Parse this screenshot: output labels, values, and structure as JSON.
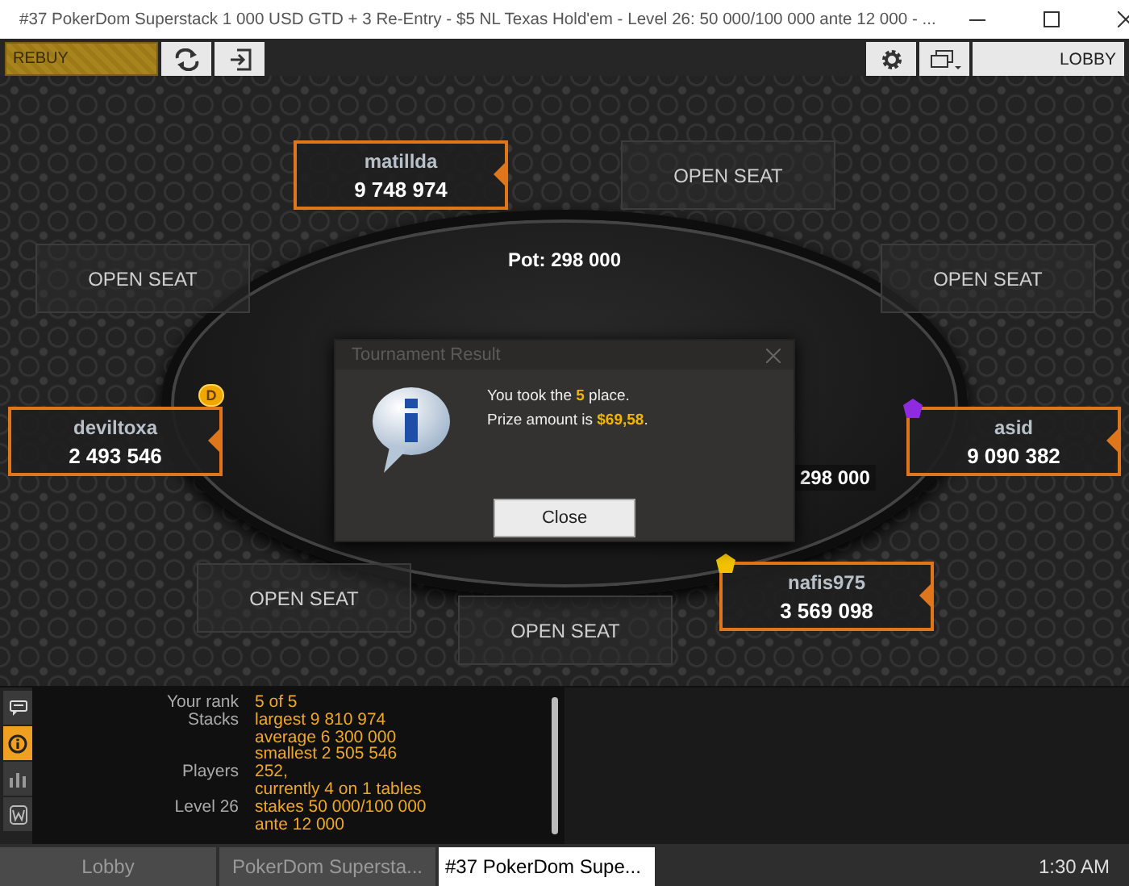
{
  "window": {
    "title": "#37 PokerDom Superstack 1 000 USD GTD + 3 Re-Entry - $5 NL Texas Hold'em - Level 26: 50 000/100 000 ante 12 000 - ..."
  },
  "toolbar": {
    "rebuy": "REBUY",
    "lobby": "LOBBY"
  },
  "table": {
    "pot": "Pot: 298 000",
    "bet": "298 000",
    "seats": [
      {
        "kind": "player",
        "name": "matillda",
        "stack": "9 748 974"
      },
      {
        "kind": "open",
        "label": "OPEN SEAT"
      },
      {
        "kind": "open",
        "label": "OPEN SEAT"
      },
      {
        "kind": "open",
        "label": "OPEN SEAT"
      },
      {
        "kind": "player",
        "name": "deviltoxa",
        "stack": "2 493 546",
        "badge": {
          "kind": "dealer",
          "label": "D"
        }
      },
      {
        "kind": "player",
        "name": "asid",
        "stack": "9 090 382",
        "badge": {
          "kind": "gem",
          "color": "#8e2be0"
        }
      },
      {
        "kind": "open",
        "label": "OPEN SEAT"
      },
      {
        "kind": "open",
        "label": "OPEN SEAT"
      },
      {
        "kind": "player",
        "name": "nafis975",
        "stack": "3 569 098",
        "badge": {
          "kind": "gem",
          "color": "#f2c200"
        }
      }
    ]
  },
  "dialog": {
    "title": "Tournament Result",
    "lines": [
      "You took the **5** place.",
      "Prize amount is **$69,58**."
    ],
    "button": "Close"
  },
  "info_panel": {
    "side_tabs": [
      {
        "kind": "chat",
        "selected": false
      },
      {
        "kind": "info",
        "selected": true
      },
      {
        "kind": "stats",
        "selected": false
      },
      {
        "kind": "notes",
        "selected": false
      }
    ],
    "rows": [
      {
        "label": "Your rank",
        "values": [
          "5 of 5"
        ]
      },
      {
        "label": "Stacks",
        "values": [
          "largest 9 810 974",
          "average 6 300 000",
          "smallest 2 505 546"
        ]
      },
      {
        "label": "Players",
        "values": [
          "252,",
          "currently 4 on 1 tables"
        ]
      },
      {
        "label": "Level 26",
        "values": [
          "stakes 50 000/100 000",
          "ante 12 000"
        ]
      }
    ]
  },
  "taskbar": {
    "tabs": [
      {
        "label": "Lobby",
        "selected": false
      },
      {
        "label": "PokerDom Supersta...",
        "selected": false
      },
      {
        "label": "#37 PokerDom Supe...",
        "selected": true
      }
    ],
    "time": "1:30 AM"
  }
}
